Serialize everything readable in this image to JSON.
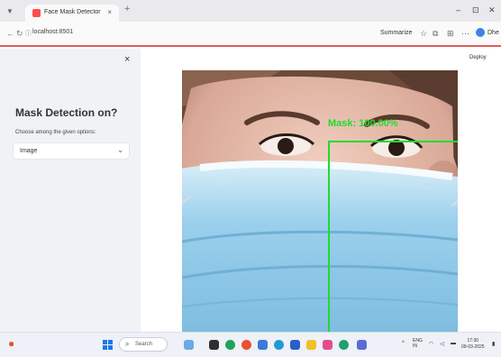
{
  "browser": {
    "tab_title": "Face Mask Detector",
    "tab_close": "×",
    "new_tab": "+",
    "tab_menu_icon": "chevron-down-icon",
    "window_controls": [
      "–",
      "⊡",
      "✕"
    ],
    "url": "localhost:8501",
    "back_icon": "arrow-left-icon",
    "reload_icon": "reload-icon",
    "site_info_icon": "info-icon",
    "summarize_label": "Summarize",
    "toolbar_icons": [
      "star-icon",
      "collections-icon",
      "extensions-icon",
      "more-icon",
      "copilot-icon"
    ],
    "profile_label": "Dhe"
  },
  "sidebar": {
    "close": "×",
    "heading": "Mask Detection on?",
    "select_label": "Choose among the given options:",
    "select_value": "Image",
    "select_chevron": "⌄"
  },
  "main": {
    "deploy_label": "Deploy",
    "detection_label": "Mask: 100.00%",
    "detection_color": "#1fdc2c"
  },
  "taskbar": {
    "search_placeholder": "Search",
    "apps": [
      "weather-icon",
      "start-icon",
      "file-explorer-icon",
      "edge-icon",
      "chrome-icon",
      "teams-icon",
      "vscode-icon",
      "store-icon",
      "folder-icon",
      "photos-icon",
      "chrome-icon",
      "vs-icon"
    ],
    "lang_top": "ENG",
    "lang_bottom": "IN",
    "time": "17:30",
    "date": "09-03-2025"
  },
  "colors": {
    "accent_red": "#ff4b4b",
    "sidebar_bg": "#f0f2f6",
    "mask_blue": "#8dc8e8",
    "box_green": "#1fdc2c"
  }
}
